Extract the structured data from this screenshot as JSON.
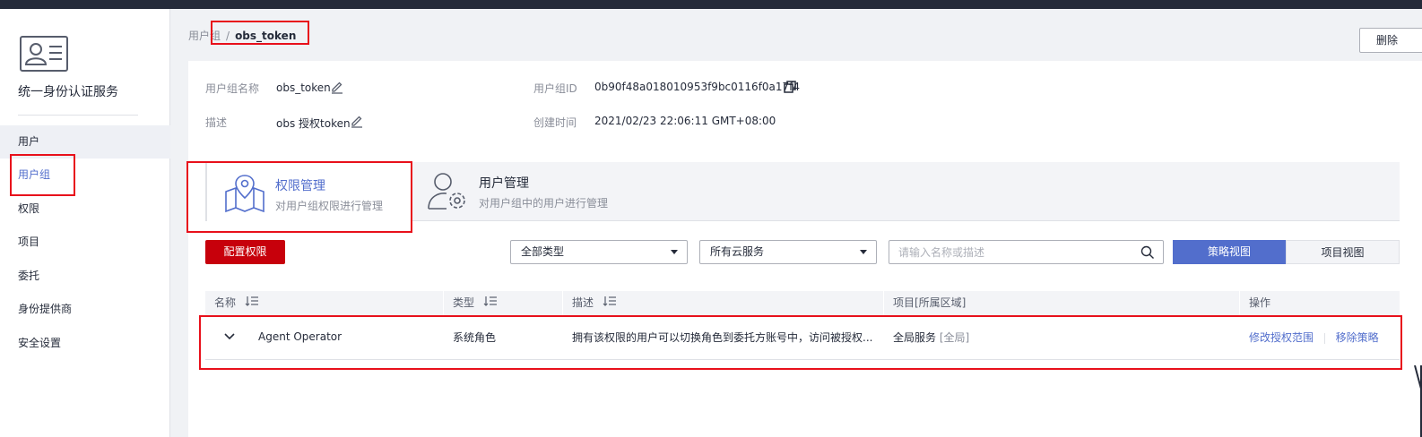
{
  "sidebar": {
    "app_title": "统一身份认证服务",
    "items": [
      {
        "label": "用户"
      },
      {
        "label": "用户组"
      },
      {
        "label": "权限"
      },
      {
        "label": "项目"
      },
      {
        "label": "委托"
      },
      {
        "label": "身份提供商"
      },
      {
        "label": "安全设置"
      }
    ]
  },
  "breadcrumb": {
    "parent": "用户组",
    "separator": "/",
    "current": "obs_token"
  },
  "header": {
    "delete_label": "删除"
  },
  "details": {
    "name_label": "用户组名称",
    "name_value": "obs_token",
    "id_label": "用户组ID",
    "id_value": "0b90f48a018010953f9bc0116f0a17f4",
    "desc_label": "描述",
    "desc_value": "obs 授权token",
    "created_label": "创建时间",
    "created_value": "2021/02/23 22:06:11 GMT+08:00"
  },
  "tabs": [
    {
      "title": "权限管理",
      "subtitle": "对用户组权限进行管理"
    },
    {
      "title": "用户管理",
      "subtitle": "对用户组中的用户进行管理"
    }
  ],
  "toolbar": {
    "configure_label": "配置权限",
    "type_select": "全部类型",
    "service_select": "所有云服务",
    "search_placeholder": "请输入名称或描述",
    "policy_view_label": "策略视图",
    "project_view_label": "项目视图"
  },
  "table": {
    "columns": [
      "名称",
      "类型",
      "描述",
      "项目[所属区域]",
      "操作"
    ],
    "rows": [
      {
        "name": "Agent Operator",
        "type": "系统角色",
        "description": "拥有该权限的用户可以切换角色到委托方账号中，访问被授权...",
        "project": "全局服务",
        "region": "[全局]",
        "action_modify": "修改授权范围",
        "action_remove": "移除策略"
      }
    ]
  },
  "colors": {
    "accent": "#526ecc",
    "primary_button": "#c7000b",
    "highlight_box": "#e8101b"
  }
}
